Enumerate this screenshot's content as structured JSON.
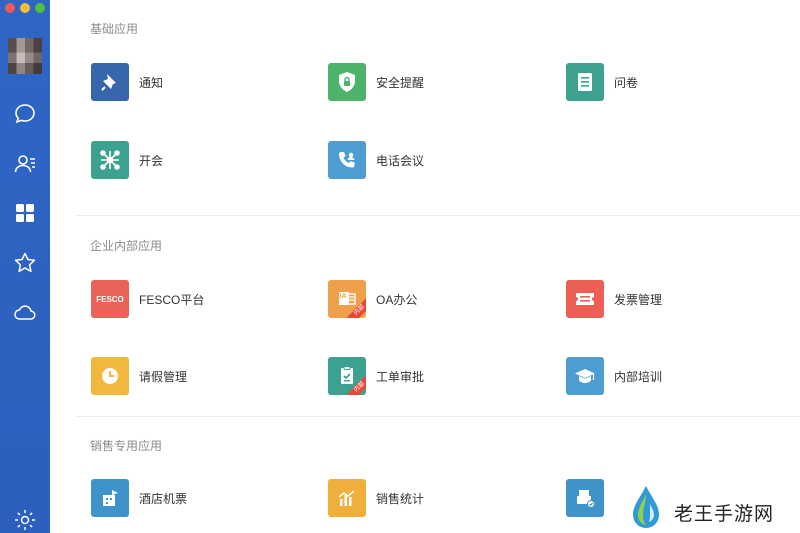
{
  "colors": {
    "sidebar": "#2f66c5",
    "navy": "#3866ad",
    "green": "#4db36a",
    "teal": "#3da18f",
    "blue": "#4d9dd3",
    "red": "#ea6259",
    "orange": "#eea14a",
    "coral": "#ec5f55",
    "yellow": "#f1b73f",
    "gold": "#f0ae3b",
    "slate": "#3f93c8"
  },
  "sidebar": {
    "icons": [
      "chat-icon",
      "contacts-icon",
      "apps-icon",
      "star-icon",
      "cloud-icon",
      "settings-icon"
    ]
  },
  "sections": [
    {
      "title": "基础应用",
      "apps": [
        {
          "label": "通知",
          "icon": "bell-icon"
        },
        {
          "label": "安全提醒",
          "icon": "shield-lock-icon"
        },
        {
          "label": "问卷",
          "icon": "questionnaire-icon"
        },
        {
          "label": "开会",
          "icon": "meeting-network-icon"
        },
        {
          "label": "电话会议",
          "icon": "phone-conference-icon"
        }
      ]
    },
    {
      "title": "企业内部应用",
      "apps": [
        {
          "label": "FESCO平台",
          "icon": "fesco-logo-icon",
          "tile_text": "FESCO"
        },
        {
          "label": "OA办公",
          "icon": "oa-document-icon",
          "tile_text": "OA",
          "ribbon": "内部"
        },
        {
          "label": "发票管理",
          "icon": "ticket-icon"
        },
        {
          "label": "请假管理",
          "icon": "clock-icon"
        },
        {
          "label": "工单审批",
          "icon": "clipboard-check-icon",
          "ribbon": "内部"
        },
        {
          "label": "内部培训",
          "icon": "graduation-cap-icon"
        }
      ]
    },
    {
      "title": "销售专用应用",
      "apps": [
        {
          "label": "酒店机票",
          "icon": "hotel-flight-icon"
        },
        {
          "label": "销售统计",
          "icon": "bar-chart-icon"
        },
        {
          "label": "",
          "icon": "printer-check-icon"
        }
      ]
    }
  ],
  "watermark": {
    "text": "老王手游网"
  }
}
